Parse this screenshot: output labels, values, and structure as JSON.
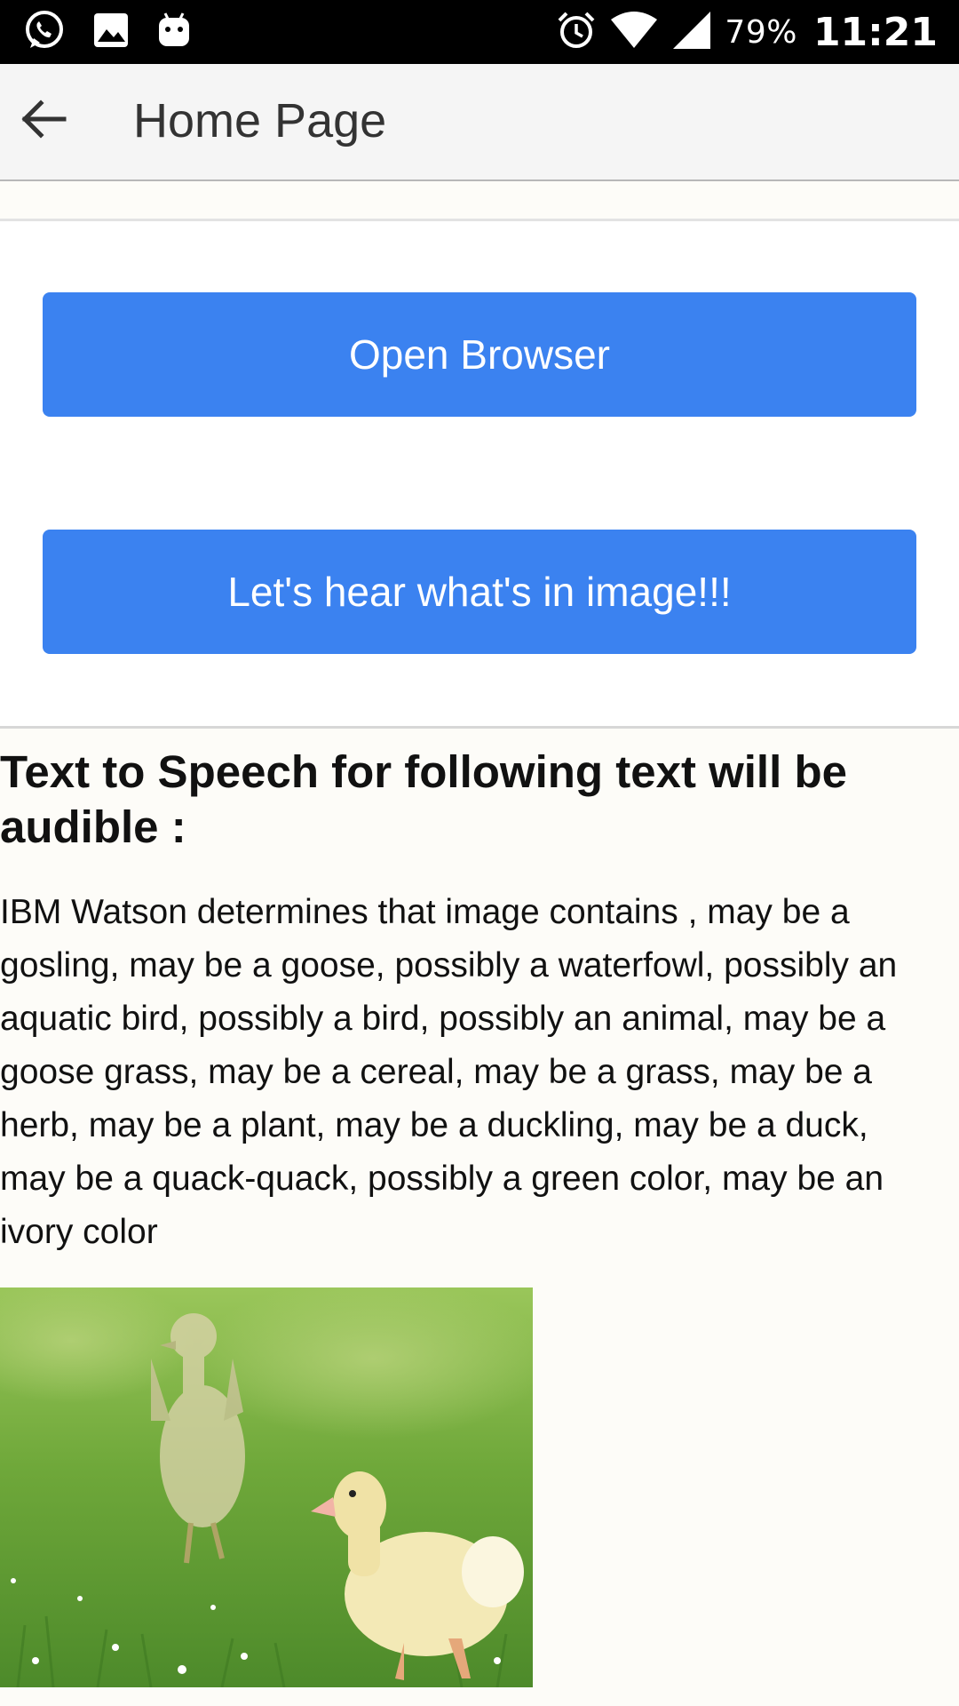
{
  "status_bar": {
    "battery": "79%",
    "time": "11:21",
    "left_icons": [
      "whatsapp-icon",
      "gallery-icon",
      "android-icon"
    ],
    "right_icons": [
      "alarm-icon",
      "wifi-icon",
      "signal-icon"
    ]
  },
  "app_bar": {
    "title": "Home Page",
    "back_icon": "arrow-left-icon"
  },
  "buttons": {
    "open_browser": "Open Browser",
    "hear_image": "Let's hear what's in image!!!"
  },
  "tts": {
    "heading": "Text to Speech for following text will be audible :",
    "body": "IBM Watson determines that image contains , may be a gosling, may be a goose, possibly a waterfowl, possibly an aquatic bird, possibly a bird, possibly an animal, may be a goose grass, may be a cereal, may be a grass, may be a herb, may be a plant, may be a duckling, may be a duck, may be a quack-quack, possibly a green color, may be an ivory color"
  },
  "colors": {
    "button_blue": "#3b82f0",
    "status_bar": "#000000",
    "app_bar": "#f5f5f5"
  }
}
